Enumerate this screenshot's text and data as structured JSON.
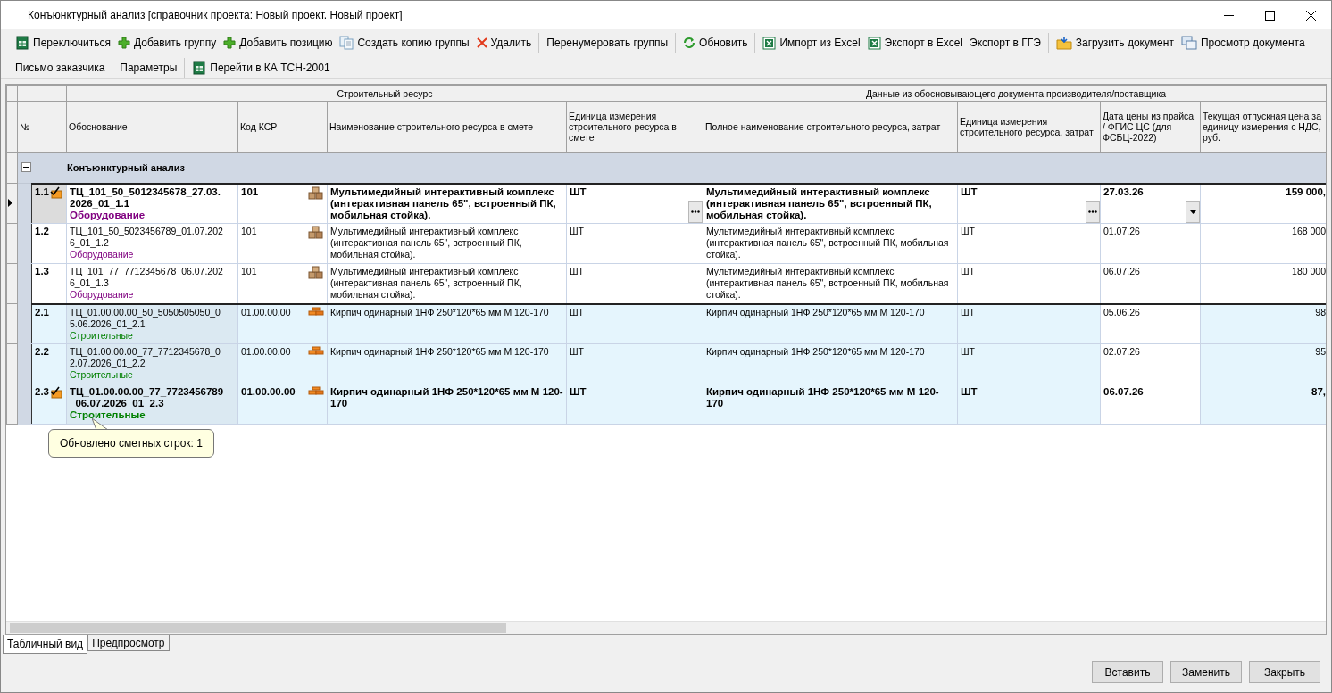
{
  "window": {
    "title": "Конъюнктурный анализ [справочник проекта: Новый проект. Новый проект]"
  },
  "toolbars": [
    {
      "groups": [
        [
          {
            "label": "Переключиться",
            "kind": "sheet"
          },
          {
            "label": "Добавить группу",
            "kind": "add"
          },
          {
            "label": "Добавить позицию",
            "kind": "add"
          },
          {
            "label": "Создать копию группы",
            "kind": "copy"
          },
          {
            "label": "Удалить",
            "kind": "delete"
          }
        ],
        [
          {
            "label": "Перенумеровать группы",
            "kind": "text"
          }
        ],
        [
          {
            "label": "Обновить",
            "kind": "refresh"
          }
        ],
        [
          {
            "label": "Импорт из Excel",
            "kind": "excel"
          },
          {
            "label": "Экспорт в Excel",
            "kind": "excel"
          },
          {
            "label": "Экспорт в ГГЭ",
            "kind": "text"
          }
        ],
        [
          {
            "label": "Загрузить документ",
            "kind": "upload"
          },
          {
            "label": "Просмотр документа",
            "kind": "preview"
          }
        ]
      ]
    },
    {
      "groups": [
        [
          {
            "label": "Письмо заказчика",
            "kind": "text"
          }
        ],
        [
          {
            "label": "Параметры",
            "kind": "text"
          }
        ],
        [
          {
            "label": "Перейти в КА ТСН-2001",
            "kind": "sheet"
          }
        ]
      ]
    }
  ],
  "grid": {
    "number_column": "№",
    "column_groups": [
      {
        "label": "Строительный ресурс",
        "columns": [
          "Обоснование",
          "Код КСР",
          "Наименование строительного ресурса в смете",
          "Единица измерения строительного ресурса в смете"
        ]
      },
      {
        "label": "Данные из обосновывающего документа производителя/поставщика",
        "columns": [
          "Полное наименование строительного ресурса, затрат",
          "Единица измерения строительного ресурса, затрат",
          "Дата цены из прайса / ФГИС ЦС (для ФСБЦ-2022)",
          "Текущая отпускная цена за единицу измерения с НДС, руб."
        ]
      }
    ],
    "group": {
      "title": "Конъюнктурный анализ",
      "expanded": true
    },
    "rows": [
      {
        "number": "1.1",
        "kind": "equipment",
        "current": true,
        "updated": true,
        "basis": "ТЦ_101_50_5012345678_27.03.2026_01_1.1",
        "category": "Оборудование",
        "code": "101",
        "name": "Мультимедийный интерактивный комплекс (интерактивная панель 65\", встроенный ПК, мобильная стойка).",
        "unit": "ШТ",
        "full_name": "Мультимедийный интерактивный комплекс (интерактивная панель 65\", встроенный ПК, мобильная стойка).",
        "unit2": "ШТ",
        "date": "27.03.26",
        "price": "159 000,"
      },
      {
        "number": "1.2",
        "kind": "equipment",
        "current": false,
        "updated": false,
        "basis": "ТЦ_101_50_5023456789_01.07.2026_01_1.2",
        "category": "Оборудование",
        "code": "101",
        "name": "Мультимедийный интерактивный комплекс (интерактивная панель 65\", встроенный ПК, мобильная стойка).",
        "unit": "ШТ",
        "full_name": "Мультимедийный интерактивный комплекс (интерактивная панель 65\", встроенный ПК, мобильная стойка).",
        "unit2": "ШТ",
        "date": "01.07.26",
        "price": "168 000"
      },
      {
        "number": "1.3",
        "kind": "equipment",
        "current": false,
        "updated": false,
        "basis": "ТЦ_101_77_7712345678_06.07.2026_01_1.3",
        "category": "Оборудование",
        "code": "101",
        "name": "Мультимедийный интерактивный комплекс (интерактивная панель 65\", встроенный ПК, мобильная стойка).",
        "unit": "ШТ",
        "full_name": "Мультимедийный интерактивный комплекс (интерактивная панель 65\", встроенный ПК, мобильная стойка).",
        "unit2": "ШТ",
        "date": "06.07.26",
        "price": "180 000"
      },
      {
        "number": "2.1",
        "kind": "material",
        "current": false,
        "updated": false,
        "basis": "ТЦ_01.00.00.00_50_5050505050_05.06.2026_01_2.1",
        "category": "Строительные",
        "code": "01.00.00.00",
        "name": "Кирпич одинарный 1НФ 250*120*65 мм М 120-170",
        "unit": "ШТ",
        "full_name": "Кирпич одинарный 1НФ 250*120*65 мм М 120-170",
        "unit2": "ШТ",
        "date": "05.06.26",
        "price": "98"
      },
      {
        "number": "2.2",
        "kind": "material",
        "current": false,
        "updated": false,
        "basis": "ТЦ_01.00.00.00_77_7712345678_02.07.2026_01_2.2",
        "category": "Строительные",
        "code": "01.00.00.00",
        "name": "Кирпич одинарный 1НФ 250*120*65 мм М 120-170",
        "unit": "ШТ",
        "full_name": "Кирпич одинарный 1НФ 250*120*65 мм М 120-170",
        "unit2": "ШТ",
        "date": "02.07.26",
        "price": "95"
      },
      {
        "number": "2.3",
        "kind": "material",
        "current": false,
        "updated": true,
        "basis": "ТЦ_01.00.00.00_77_7723456789_06.07.2026_01_2.3",
        "category": "Строительные",
        "code": "01.00.00.00",
        "name": "Кирпич одинарный 1НФ 250*120*65 мм М 120-170",
        "unit": "ШТ",
        "full_name": "Кирпич одинарный 1НФ 250*120*65 мм М 120-170",
        "unit2": "ШТ",
        "date": "06.07.26",
        "price": "87,"
      }
    ]
  },
  "tooltip": "Обновлено сметных строк: 1",
  "tabs": [
    {
      "label": "Табличный вид",
      "selected": true
    },
    {
      "label": "Предпросмотр",
      "selected": false
    }
  ],
  "buttons": [
    "Вставить",
    "Заменить",
    "Закрыть"
  ]
}
